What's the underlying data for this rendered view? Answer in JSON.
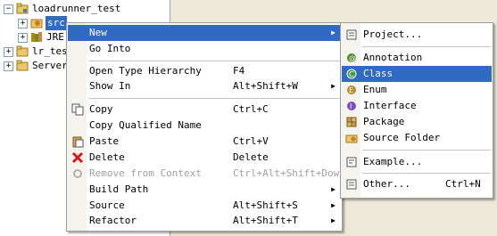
{
  "tree": {
    "items": [
      {
        "label": "loadrunner_test",
        "expander": "−"
      },
      {
        "label": "src",
        "expander": "+"
      },
      {
        "label": "JRE",
        "expander": "+"
      },
      {
        "label": "lr_test",
        "expander": "+"
      },
      {
        "label": "Servers",
        "expander": "+"
      }
    ]
  },
  "context_menu": {
    "items": [
      {
        "label": "New",
        "arrow": "▶"
      },
      {
        "label": "Go Into"
      },
      {
        "label": "Open Type Hierarchy",
        "accel": "F4"
      },
      {
        "label": "Show In",
        "accel": "Alt+Shift+W",
        "arrow": "▶"
      },
      {
        "label": "Copy",
        "accel": "Ctrl+C"
      },
      {
        "label": "Copy Qualified Name"
      },
      {
        "label": "Paste",
        "accel": "Ctrl+V"
      },
      {
        "label": "Delete",
        "accel": "Delete"
      },
      {
        "label": "Remove from Context",
        "accel": "Ctrl+Alt+Shift+Down"
      },
      {
        "label": "Build Path",
        "arrow": "▶"
      },
      {
        "label": "Source",
        "accel": "Alt+Shift+S",
        "arrow": "▶"
      },
      {
        "label": "Refactor",
        "accel": "Alt+Shift+T",
        "arrow": "▶"
      }
    ]
  },
  "new_submenu": {
    "items": [
      {
        "label": "Project..."
      },
      {
        "label": "Annotation"
      },
      {
        "label": "Class"
      },
      {
        "label": "Enum"
      },
      {
        "label": "Interface"
      },
      {
        "label": "Package"
      },
      {
        "label": "Source Folder"
      },
      {
        "label": "Example..."
      },
      {
        "label": "Other...",
        "accel": "Ctrl+N"
      }
    ]
  },
  "colors": {
    "highlight": "#316ac5",
    "menu_bg": "#ffffff",
    "gutter": "#f4f3ee",
    "workbench": "#ece9d8"
  }
}
